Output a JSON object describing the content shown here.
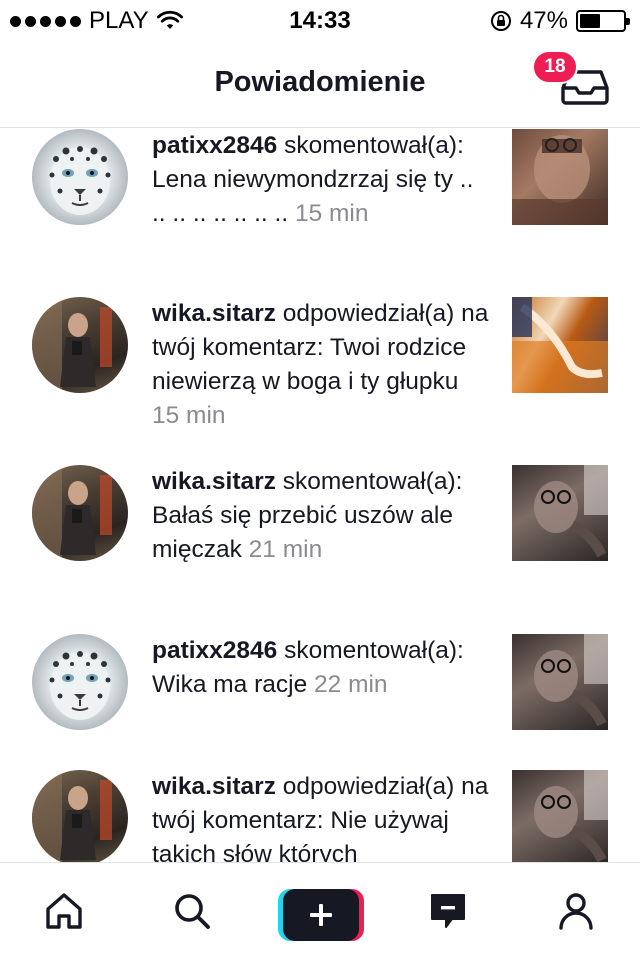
{
  "status_bar": {
    "carrier": "PLAY",
    "time": "14:33",
    "battery_percent": "47%",
    "battery_level": 0.47
  },
  "header": {
    "title": "Powiadomienie",
    "inbox_badge": "18",
    "inbox_icon": "inbox-tray-icon"
  },
  "notifications": [
    {
      "username": "patixx2846",
      "text": " skomentował(a): Lena niewymondzrzaj się ty .. .. .. .. .. .. .. .. ",
      "time": "15 min"
    },
    {
      "username": "wika.sitarz",
      "text": " odpowiedział(a) na twój komentarz: Twoi rodzice niewierzą w boga i ty głupku ",
      "time": "15 min"
    },
    {
      "username": "wika.sitarz",
      "text": " skomentował(a): Bałaś się przebić uszów ale mięczak ",
      "time": "21 min"
    },
    {
      "username": "patixx2846",
      "text": " skomentował(a): Wika ma racje ",
      "time": "22 min"
    },
    {
      "username": "wika.sitarz",
      "text": " odpowiedział(a) na twój komentarz: Nie używaj takich słów których",
      "time": ""
    }
  ],
  "bottom_nav": {
    "items": [
      "home-icon",
      "search-icon",
      "create-plus-icon",
      "inbox-message-icon",
      "profile-icon"
    ]
  },
  "colors": {
    "accent_red": "#ee1d52",
    "accent_cyan": "#20d5ec",
    "text_primary": "#161823",
    "text_secondary": "#8a8b91"
  }
}
